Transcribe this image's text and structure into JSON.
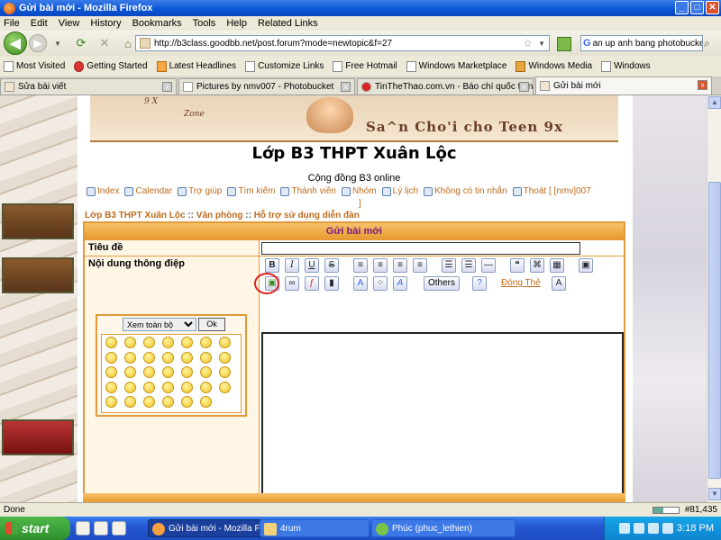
{
  "window": {
    "title": "Gửi bài mới - Mozilla Firefox",
    "minimize": "_",
    "maximize": "□",
    "close": "✕"
  },
  "menu": [
    "File",
    "Edit",
    "View",
    "History",
    "Bookmarks",
    "Tools",
    "Help",
    "Related Links"
  ],
  "nav": {
    "url": "http://b3class.goodbb.net/post.forum?mode=newtopic&f=27",
    "search_value": "an up anh bang photobucket",
    "search_engine_label": "G",
    "back_icon": "back-arrow-icon",
    "forward_icon": "forward-arrow-icon",
    "reload_icon": "reload-icon",
    "stop_icon": "stop-icon",
    "home_icon": "home-icon"
  },
  "bookmarks": [
    "Most Visited",
    "Getting Started",
    "Latest Headlines",
    "Customize Links",
    "Free Hotmail",
    "Windows Marketplace",
    "Windows Media",
    "Windows"
  ],
  "tabs": [
    {
      "label": "Sửa bài viết",
      "active": false
    },
    {
      "label": "Pictures by nmv007 - Photobucket",
      "active": false
    },
    {
      "label": "TinTheThao.com.vn - Báo chí quốc tế n...",
      "active": false
    },
    {
      "label": "Gửi bài mới",
      "active": true
    }
  ],
  "banner": {
    "small_text": "9 X",
    "zone_text": "Zone",
    "title": "Sa^n Cho'i cho Teen 9x"
  },
  "page": {
    "title": "Lớp B3 THPT Xuân Lộc",
    "subtitle": "Cộng đồng B3 online",
    "nav_links": [
      "Index",
      "Calendar",
      "Trợ giúp",
      "Tìm kiếm",
      "Thành viên",
      "Nhóm",
      "Lý lịch",
      "Không có tin nhắn",
      "Thoát [ [nmv]007"
    ],
    "nav_close": "]",
    "breadcrumb": [
      "Lớp B3 THPT Xuân Lộc",
      "Văn phòng",
      "Hỗ trợ sử dụng diễn đàn"
    ],
    "breadcrumb_sep": "::"
  },
  "form": {
    "header": "Gửi bài mới",
    "subject_label": "Tiêu đề",
    "subject_value": "",
    "message_label": "Nội dung thông điệp",
    "toolbar_row1": [
      "B",
      "I",
      "U",
      "S"
    ],
    "others_label": "Others",
    "link_label": "Đóng Thẻ",
    "font_size_label": "A",
    "smiley_select": "Xem toàn bộ",
    "smiley_ok": "Ok",
    "smiley_count": 34,
    "message_value": ""
  },
  "statusbar": {
    "text": "Done",
    "counter": "#81,435"
  },
  "taskbar": {
    "start": "start",
    "tasks": [
      {
        "label": "Gửi bài mới - Mozilla F...",
        "active": true
      },
      {
        "label": "4rum",
        "active": false
      },
      {
        "label": "Phúc (phuc_lethien)",
        "active": false
      }
    ],
    "time": "3:18 PM"
  },
  "colors": {
    "accent": "#e09a3a",
    "link": "#c06a1a",
    "header_text": "#7a1f80",
    "highlight_ring": "#e02020"
  }
}
